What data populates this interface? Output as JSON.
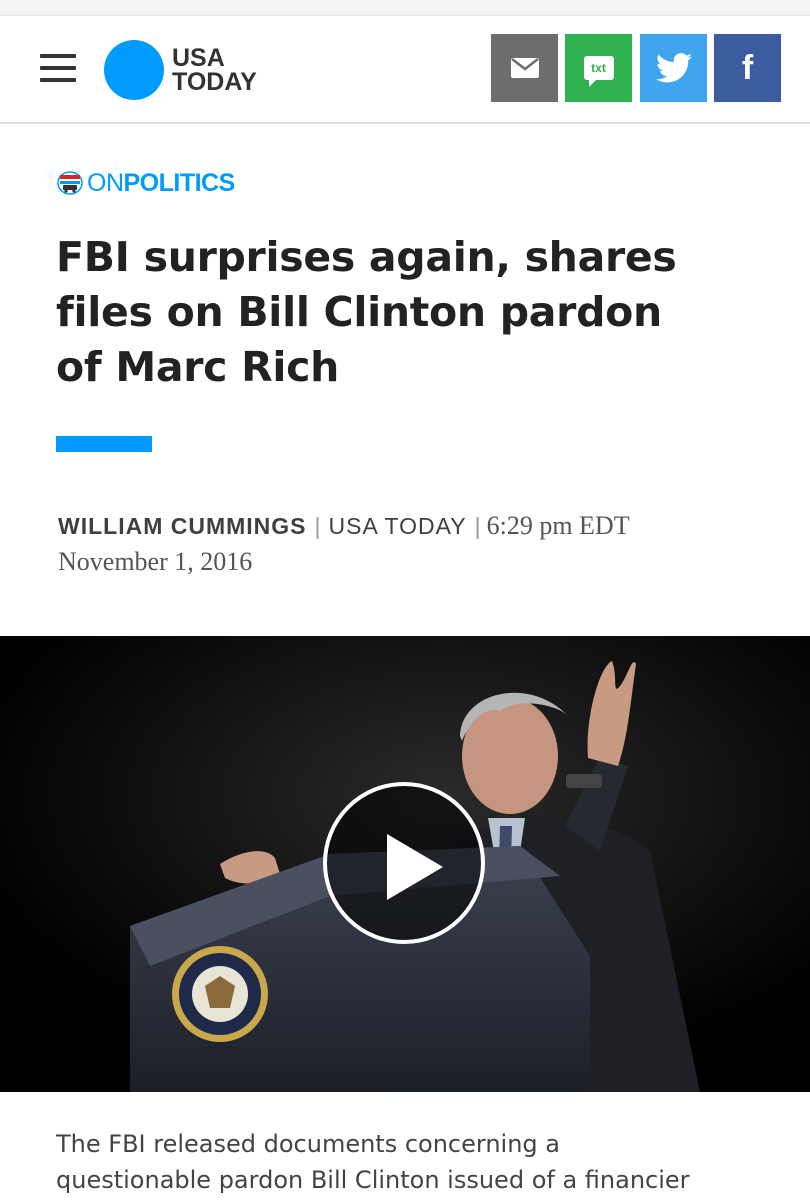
{
  "header": {
    "logo_line1": "USA",
    "logo_line2": "TODAY",
    "brand_color": "#009bff",
    "share_buttons": [
      {
        "name": "email",
        "icon": "envelope-icon",
        "color": "#6d6d6d"
      },
      {
        "name": "text",
        "label": "txt",
        "icon": "chat-bubble-icon",
        "color": "#2fb14f"
      },
      {
        "name": "twitter",
        "icon": "twitter-bird-icon",
        "color": "#3fa6ee"
      },
      {
        "name": "facebook",
        "label": "f",
        "icon": "facebook-icon",
        "color": "#3b5c9f"
      }
    ]
  },
  "section": {
    "prefix": "ON",
    "name": "POLITICS",
    "icon": "election-elephant-icon"
  },
  "article": {
    "headline_lines": [
      "FBI surprises again, shares",
      "files on Bill Clinton pardon",
      "of Marc Rich"
    ],
    "author": "WILLIAM CUMMINGS",
    "outlet": "USA TODAY",
    "time": "6:29 pm EDT",
    "date": "November 1, 2016",
    "body_lines": [
      "The FBI released documents concerning a",
      "questionable pardon Bill Clinton issued of a financier"
    ]
  },
  "video": {
    "icon": "play-icon"
  }
}
